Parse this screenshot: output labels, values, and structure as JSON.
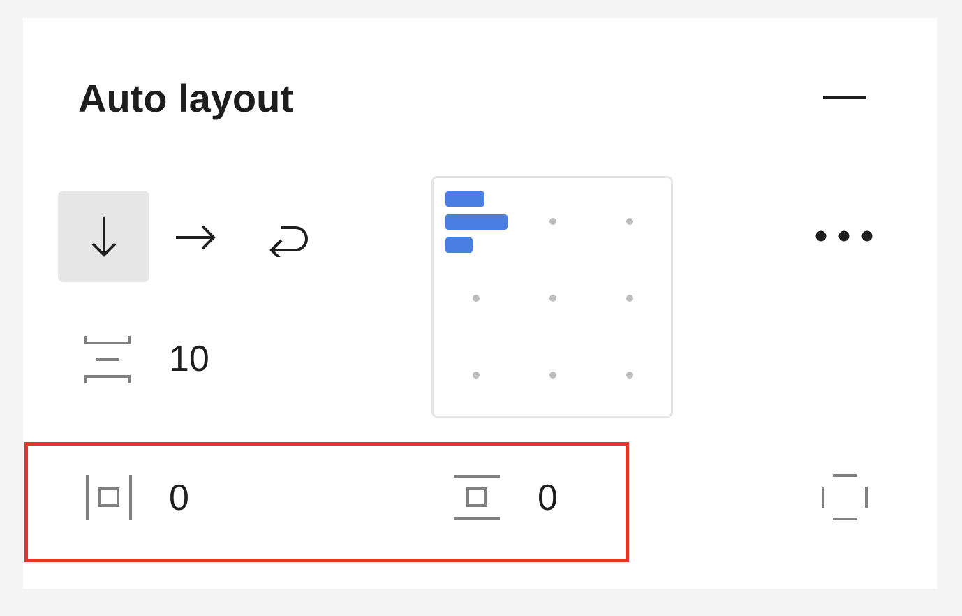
{
  "auto_layout": {
    "title": "Auto layout",
    "collapse_icon": "minus-icon",
    "direction": {
      "options": [
        {
          "icon": "arrow-down-icon",
          "name": "vertical"
        },
        {
          "icon": "arrow-right-icon",
          "name": "horizontal"
        },
        {
          "icon": "wrap-arrow-icon",
          "name": "wrap"
        }
      ],
      "selected": "vertical"
    },
    "gap": {
      "icon": "vertical-spacing-icon",
      "value": "10"
    },
    "alignment": {
      "selected": "top-left",
      "accent": "#4a7ee0"
    },
    "more_icon": "more-horizontal-icon",
    "padding": {
      "horizontal": {
        "icon": "horizontal-padding-icon",
        "value": "0"
      },
      "vertical": {
        "icon": "vertical-padding-icon",
        "value": "0"
      },
      "individual_icon": "individual-padding-icon"
    },
    "highlight_color": "#e5352b"
  }
}
